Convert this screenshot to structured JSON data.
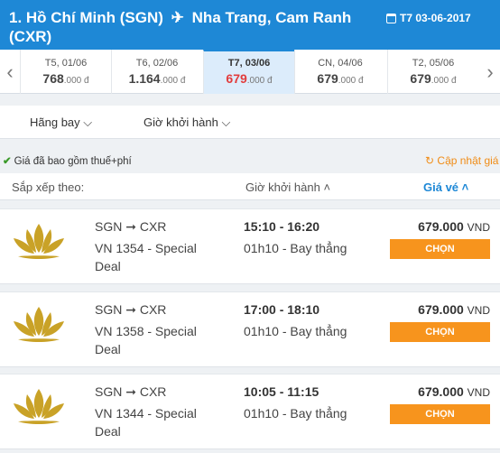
{
  "header": {
    "origin": "1. Hồ Chí Minh (SGN)",
    "plane_glyph": "✈",
    "destination": "Nha Trang, Cam Ranh (CXR)",
    "date": "T7 03-06-2017"
  },
  "datebar": {
    "days": [
      {
        "label": "T5, 01/06",
        "price": "768",
        "unit": ".000 đ"
      },
      {
        "label": "T6, 02/06",
        "price": "1.164",
        "unit": ".000 đ"
      },
      {
        "label": "T7, 03/06",
        "price": "679",
        "unit": ".000 đ",
        "active": true
      },
      {
        "label": "CN, 04/06",
        "price": "679",
        "unit": ".000 đ"
      },
      {
        "label": "T2, 05/06",
        "price": "679",
        "unit": ".000 đ"
      }
    ]
  },
  "filters": {
    "airline": "Hãng bay",
    "depart_time": "Giờ khởi hành",
    "chevron": "⌵"
  },
  "note": {
    "check": "✔",
    "text": "Giá đã bao gồm thuế+phí",
    "refresh_icon": "↻",
    "update": "Cập nhật giá"
  },
  "sort": {
    "label": "Sắp xếp theo:",
    "time": "Giờ khởi hành",
    "price": "Giá vé",
    "caret": "˄"
  },
  "flights": [
    {
      "segment": "SGN ➞ CXR",
      "flight_no": "VN 1354 - Special Deal",
      "times": "15:10 - 16:20",
      "duration": "01h10 - Bay thẳng",
      "price": "679.000",
      "currency": "VND",
      "button": "CHỌN"
    },
    {
      "segment": "SGN ➞ CXR",
      "flight_no": "VN 1358 - Special Deal",
      "times": "17:00 - 18:10",
      "duration": "01h10 - Bay thẳng",
      "price": "679.000",
      "currency": "VND",
      "button": "CHỌN"
    },
    {
      "segment": "SGN ➞ CXR",
      "flight_no": "VN 1344 - Special Deal",
      "times": "10:05 - 11:15",
      "duration": "01h10 - Bay thẳng",
      "price": "679.000",
      "currency": "VND",
      "button": "CHỌN"
    }
  ],
  "colors": {
    "header": "#1e88d6",
    "button": "#f7941d",
    "active_price": "#e23c3c",
    "logo_gold": "#c9a227"
  }
}
